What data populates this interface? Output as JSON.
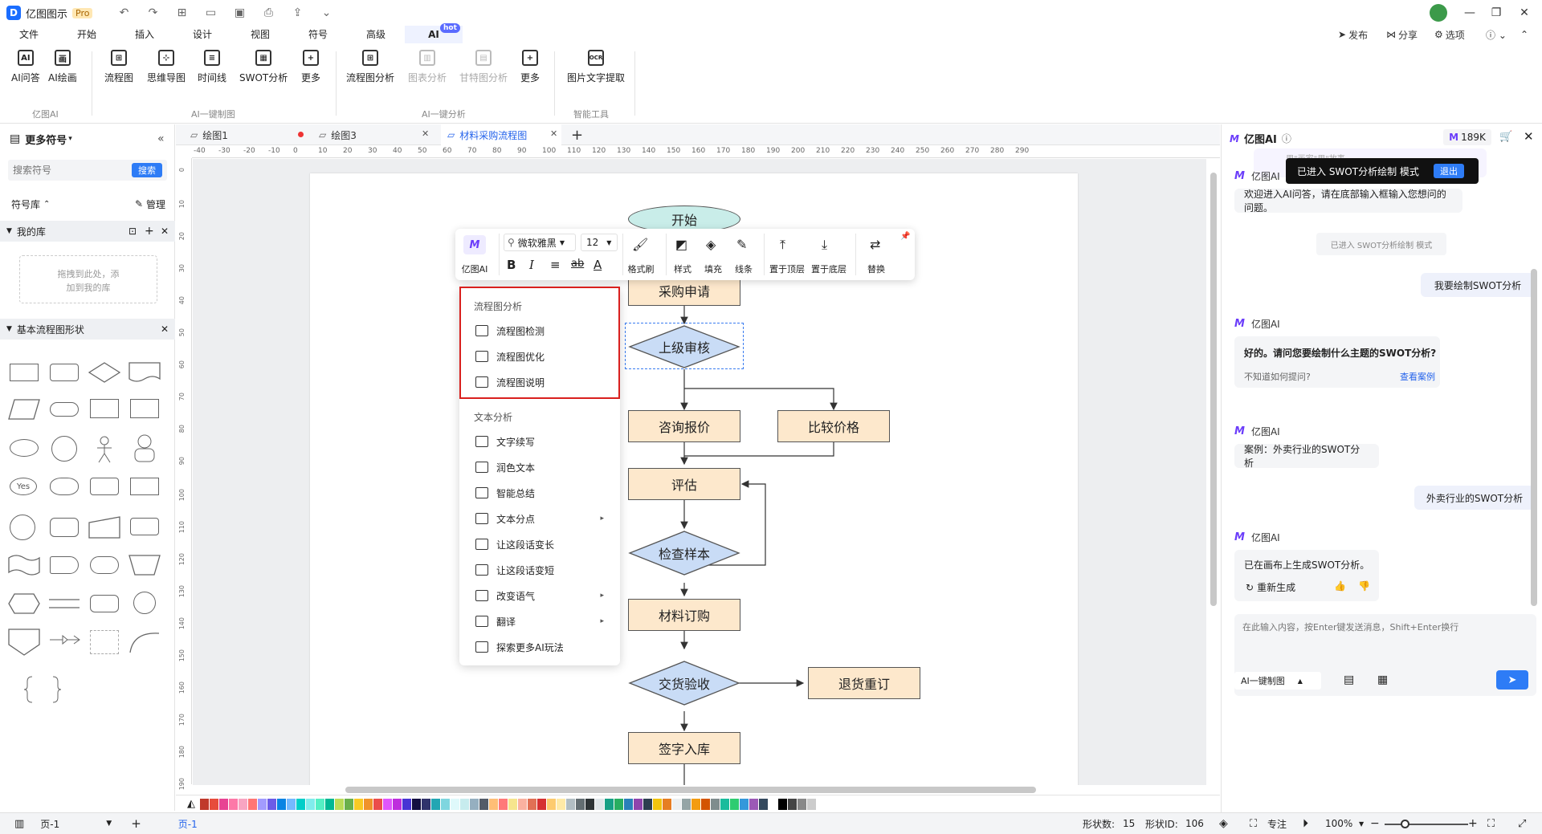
{
  "app": {
    "name": "亿图图示",
    "badge": "Pro"
  },
  "menu": {
    "tabs": [
      "文件",
      "开始",
      "插入",
      "设计",
      "视图",
      "符号",
      "高级",
      "AI"
    ],
    "hot_badge": "hot",
    "right": {
      "publish": "发布",
      "share": "分享",
      "options": "选项"
    }
  },
  "ribbon": {
    "buttons": [
      {
        "label": "AI问答",
        "icon": "ai-chat-icon",
        "glyph": "AI"
      },
      {
        "label": "AI绘画",
        "icon": "ai-paint-icon",
        "glyph": "画"
      },
      {
        "label": "流程图",
        "icon": "flowchart-icon",
        "glyph": "⊞"
      },
      {
        "label": "思维导图",
        "icon": "mindmap-icon",
        "glyph": "⊹"
      },
      {
        "label": "时间线",
        "icon": "timeline-icon",
        "glyph": "≡"
      },
      {
        "label": "SWOT分析",
        "icon": "swot-icon",
        "glyph": "▦"
      },
      {
        "label": "更多",
        "icon": "more-icon",
        "glyph": "+"
      },
      {
        "label": "流程图分析",
        "icon": "flow-analysis-icon",
        "glyph": "⊞"
      },
      {
        "label": "图表分析",
        "icon": "chart-analysis-icon",
        "glyph": "▥"
      },
      {
        "label": "甘特图分析",
        "icon": "gantt-analysis-icon",
        "glyph": "▤"
      },
      {
        "label": "更多",
        "icon": "more-icon",
        "glyph": "+"
      },
      {
        "label": "图片文字提取",
        "icon": "ocr-icon",
        "glyph": "OCR"
      }
    ],
    "groups": [
      "亿图AI",
      "AI一键制图",
      "AI一键分析",
      "智能工具"
    ]
  },
  "left": {
    "title": "更多符号",
    "search_placeholder": "搜索符号",
    "search_button": "搜索",
    "library_label": "符号库",
    "manage_label": "管理",
    "my_library": "我的库",
    "drop_hint_1": "拖拽到此处，添",
    "drop_hint_2": "加到我的库",
    "basic_shapes": "基本流程图形状",
    "yes_label": "Yes"
  },
  "doc_tabs": [
    {
      "label": "绘图1"
    },
    {
      "label": "绘图3"
    },
    {
      "label": "材料采购流程图"
    }
  ],
  "ruler": {
    "h": [
      "-40",
      "-30",
      "-20",
      "-10",
      "0",
      "10",
      "20",
      "30",
      "40",
      "50",
      "60",
      "70",
      "80",
      "90",
      "100",
      "110",
      "120",
      "130",
      "140",
      "150",
      "160",
      "170",
      "180",
      "190",
      "200",
      "210",
      "220",
      "230",
      "240",
      "250",
      "260",
      "270",
      "280",
      "290"
    ],
    "v": [
      "0",
      "10",
      "20",
      "30",
      "40",
      "50",
      "60",
      "70",
      "80",
      "90",
      "100",
      "110",
      "120",
      "130",
      "140",
      "150",
      "160",
      "170",
      "180",
      "190"
    ]
  },
  "flow": {
    "start": "开始",
    "request": "采购申请",
    "review": "上级审核",
    "inquiry": "咨询报价",
    "compare": "比较价格",
    "evaluate": "评估",
    "sample": "检查样本",
    "order": "材料订购",
    "accept": "交货验收",
    "return": "退货重订",
    "sign": "签字入库"
  },
  "toolbar": {
    "ai": "亿图AI",
    "font": "微软雅黑",
    "size": "12",
    "format_brush": "格式刷",
    "style": "样式",
    "fill": "填充",
    "line": "线条",
    "to_top": "置于顶层",
    "to_bottom": "置于底层",
    "replace": "替换"
  },
  "ai_menu": {
    "section1": "流程图分析",
    "items1": [
      "流程图检测",
      "流程图优化",
      "流程图说明"
    ],
    "section2": "文本分析",
    "items2": [
      "文字续写",
      "润色文本",
      "智能总结",
      "文本分点",
      "让这段话变长",
      "让这段话变短",
      "改变语气",
      "翻译",
      "探索更多AI玩法"
    ]
  },
  "right": {
    "title": "亿图AI",
    "tokens": "189K",
    "mode_banner": "已进入 SWOT分析绘制 模式",
    "exit": "退出",
    "bot_name": "亿图AI",
    "welcome": "欢迎进入AI问答，请在底部输入框输入您想问的问题。",
    "mode_notice": "已进入 SWOT分析绘制 模式",
    "user1": "我要绘制SWOT分析",
    "ask_topic": "好的。请问您要绘制什么主题的SWOT分析?",
    "hint": "不知道如何提问?",
    "view_case": "查看案例",
    "case": "案例：外卖行业的SWOT分析",
    "user2": "外卖行业的SWOT分析",
    "generated": "已在画布上生成SWOT分析。",
    "regenerate": "重新生成",
    "input_placeholder": "在此输入内容，按Enter键发送消息，Shift+Enter换行",
    "mode_select": "AI一键制图",
    "top_hint": "用\"画家\"用\"故事"
  },
  "status": {
    "page_select": "页-1",
    "page_tab": "页-1",
    "shape_count_label": "形状数:",
    "shape_count": "15",
    "shape_id_label": "形状ID:",
    "shape_id": "106",
    "focus": "专注",
    "zoom": "100%"
  },
  "palette": [
    "#c0392b",
    "#e74c3c",
    "#e84393",
    "#fd79a8",
    "#f8a5c2",
    "#ff7675",
    "#a29bfe",
    "#6c5ce7",
    "#0984e3",
    "#74b9ff",
    "#00cec9",
    "#81ecec",
    "#55efc4",
    "#00b894",
    "#badc58",
    "#6ab04c",
    "#f9ca24",
    "#f0932b",
    "#eb4d4b",
    "#e056fd",
    "#be2edd",
    "#4834d4",
    "#130f40",
    "#30336b",
    "#22a6b3",
    "#7ed6df",
    "#dff9fb",
    "#c7ecee",
    "#95afc0",
    "#535c68",
    "#ffbe76",
    "#ff7979",
    "#f6e58d",
    "#fab1a0",
    "#e17055",
    "#d63031",
    "#fdcb6e",
    "#ffeaa7",
    "#b2bec3",
    "#636e72",
    "#2d3436",
    "#dfe6e9",
    "#16a085",
    "#27ae60",
    "#2980b9",
    "#8e44ad",
    "#2c3e50",
    "#f1c40f",
    "#e67e22",
    "#ecf0f1",
    "#95a5a6",
    "#f39c12",
    "#d35400",
    "#7f8c8d",
    "#1abc9c",
    "#2ecc71",
    "#3498db",
    "#9b59b6",
    "#34495e",
    "#ffffff",
    "#000000",
    "#444444",
    "#888888",
    "#cccccc"
  ]
}
